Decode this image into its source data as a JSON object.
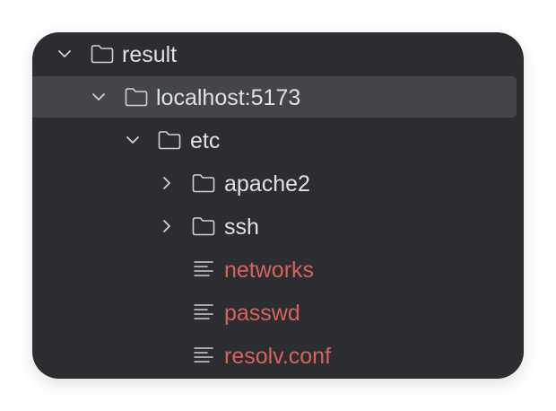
{
  "tree": {
    "items": [
      {
        "label": "result",
        "kind": "folder",
        "expanded": true,
        "depth": 0
      },
      {
        "label": "localhost:5173",
        "kind": "folder",
        "expanded": true,
        "depth": 1,
        "selected": true
      },
      {
        "label": "etc",
        "kind": "folder",
        "expanded": true,
        "depth": 2
      },
      {
        "label": "apache2",
        "kind": "folder",
        "expanded": false,
        "depth": 3
      },
      {
        "label": "ssh",
        "kind": "folder",
        "expanded": false,
        "depth": 3
      },
      {
        "label": "networks",
        "kind": "file",
        "depth": 3
      },
      {
        "label": "passwd",
        "kind": "file",
        "depth": 3
      },
      {
        "label": "resolv.conf",
        "kind": "file",
        "depth": 3
      }
    ]
  },
  "colors": {
    "panel_background": "#2b2d30",
    "selection": "#43454a",
    "text": "#dfe1e5",
    "modified_file_text": "#d7635f",
    "icon": "#cfd1d6"
  },
  "icons": {
    "expanded": "chevron-down-icon",
    "collapsed": "chevron-right-icon",
    "folder": "folder-icon",
    "file": "text-file-icon"
  }
}
